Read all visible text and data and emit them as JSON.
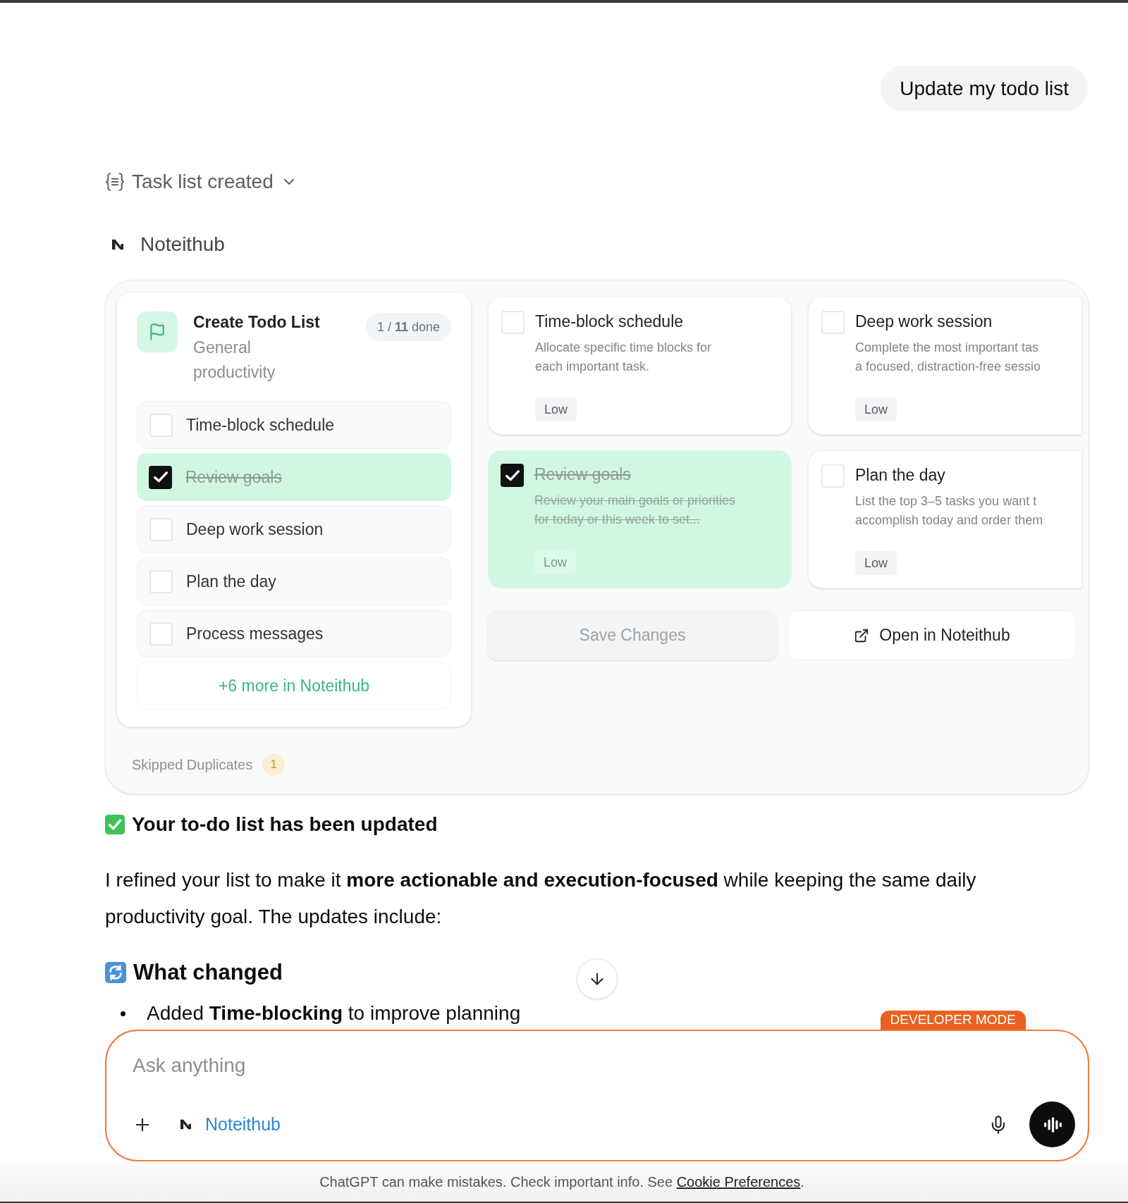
{
  "user_message": "Update my todo list",
  "tool_call": {
    "label": "Task list created",
    "expanded": false
  },
  "app": {
    "name": "Noteithub"
  },
  "widget": {
    "list": {
      "title": "Create Todo List",
      "subtitle": "General productivity",
      "progress": "1 / **11** done",
      "items": [
        {
          "label": "Time-block schedule",
          "checked": false
        },
        {
          "label": "Review goals",
          "checked": true
        },
        {
          "label": "Deep work session",
          "checked": false
        },
        {
          "label": "Plan the day",
          "checked": false
        },
        {
          "label": "Process messages",
          "checked": false
        }
      ],
      "more": "+6 more in Noteithub"
    },
    "cards": [
      {
        "title": "Time-block schedule",
        "description_lines": [
          "Allocate specific time blocks for",
          "each important task."
        ],
        "priority": "Low",
        "checked": false
      },
      {
        "title": "Deep work session",
        "description_lines": [
          "Complete the most important tas",
          "a focused, distraction-free sessio"
        ],
        "priority": "Low",
        "checked": false
      },
      {
        "title": "Review goals",
        "description_lines": [
          "Review your main goals or priorities",
          "for today or this week to set..."
        ],
        "priority": "Low",
        "checked": true
      },
      {
        "title": "Plan the day",
        "description_lines": [
          "List the top 3–5 tasks you want t",
          "accomplish today and order them"
        ],
        "priority": "Low",
        "checked": false
      }
    ],
    "buttons": [
      {
        "label": "Save Changes",
        "kind": "save",
        "disabled": true
      },
      {
        "label": "Open in Noteithub",
        "kind": "external",
        "disabled": false
      }
    ],
    "skipped": {
      "label": "Skipped Duplicates",
      "count": "1"
    }
  },
  "reply": {
    "heading": "Your to-do list has been updated",
    "paragraph": "I refined your list to make it **more actionable and execution-focused** while keeping the same daily productivity goal. The updates include:",
    "section": "What changed",
    "bullets": [
      "Added **Time-blocking** to improve planning"
    ]
  },
  "composer": {
    "badge": "DEVELOPER MODE",
    "placeholder": "Ask anything",
    "app_chip": "Noteithub"
  },
  "footer": {
    "text": "ChatGPT can make mistakes. Check important info. See",
    "link": "Cookie Preferences",
    "end": "."
  }
}
